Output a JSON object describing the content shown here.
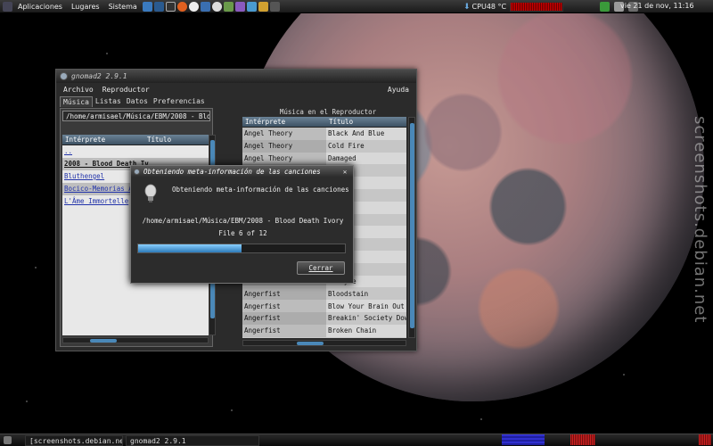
{
  "top_panel": {
    "menus": [
      "Aplicaciones",
      "Lugares",
      "Sistema"
    ],
    "cpu_label": "CPU48 °C",
    "clock": "vie 21 de nov, 11:16"
  },
  "watermark": "screenshots.debian.net",
  "main_window": {
    "title": "gnomad2 2.9.1",
    "menu": [
      "Archivo",
      "Reproductor"
    ],
    "help": "Ayuda",
    "tabs": [
      "Música",
      "Listas",
      "Datos",
      "Preferencias"
    ],
    "left": {
      "path": "/home/armisael/Música/EBM/2008 - Bloo",
      "columns": [
        "Intérprete",
        "Título"
      ],
      "rows": [
        "..",
        "2008 - Blood Death Iv",
        "Bluthengel",
        "Bocico-Memorias_A",
        "L'Âme Immortelle"
      ]
    },
    "right": {
      "title": "Música en el Reproductor",
      "columns": [
        "Intérprete",
        "Título"
      ],
      "rows": [
        [
          "Angel Theory",
          "Black And Blue"
        ],
        [
          "Angel Theory",
          "Cold Fire"
        ],
        [
          "Angel Theory",
          "Damaged"
        ],
        [
          "",
          ""
        ],
        [
          "",
          ")"
        ],
        [
          "",
          ""
        ],
        [
          "",
          "ms"
        ],
        [
          "",
          "Attack"
        ],
        [
          "",
          "a"
        ],
        [
          "",
          "sion"
        ],
        [
          "",
          "ession"
        ],
        [
          "",
          "aste"
        ],
        [
          "",
          "s Style"
        ],
        [
          "Angerfist",
          "Bloodstain"
        ],
        [
          "Angerfist",
          "Blow Your Brain Out"
        ],
        [
          "Angerfist",
          "Breakin' Society Dow"
        ],
        [
          "Angerfist",
          "Broken Chain"
        ]
      ]
    }
  },
  "dialog": {
    "title": "Obteniendo meta-información de las canciones",
    "header": "Obteniendo meta-información de las canciones",
    "path": "/home/armisael/Música/EBM/2008 - Blood Death Ivory",
    "file_status": "File 6 of 12",
    "progress": 0.5,
    "close_label": "Cerrar"
  },
  "taskbar": {
    "browser": "[screenshots.debian.ne…",
    "gnomad": "gnomad2 2.9.1"
  },
  "colors": {
    "accent": "#4a88b8",
    "progress": "#5ab0f0",
    "cpu_graph": "#cc0000"
  }
}
